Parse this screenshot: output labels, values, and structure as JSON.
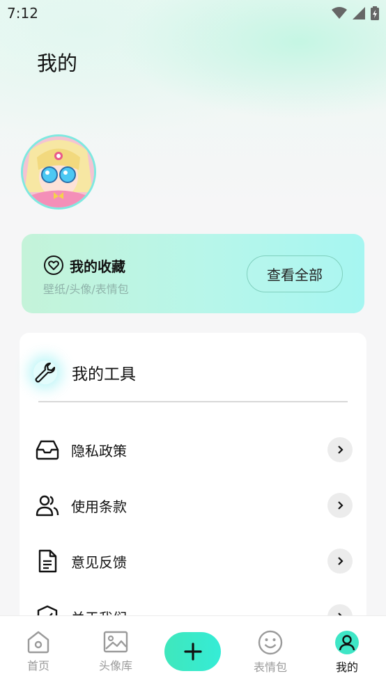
{
  "status_bar": {
    "time": "7:12"
  },
  "page": {
    "title": "我的"
  },
  "favorites": {
    "title": "我的收藏",
    "subtitle": "壁纸/头像/表情包",
    "view_all_label": "查看全部"
  },
  "tools": {
    "title": "我的工具",
    "items": [
      {
        "label": "隐私政策",
        "icon": "inbox-icon"
      },
      {
        "label": "使用条款",
        "icon": "users-icon"
      },
      {
        "label": "意见反馈",
        "icon": "document-icon"
      },
      {
        "label": "关于我们",
        "icon": "shield-check-icon"
      }
    ]
  },
  "bottom_nav": {
    "items": [
      {
        "label": "首页",
        "icon": "home-icon"
      },
      {
        "label": "头像库",
        "icon": "image-icon"
      },
      {
        "label": "",
        "icon": "plus-icon"
      },
      {
        "label": "表情包",
        "icon": "smiley-icon"
      },
      {
        "label": "我的",
        "icon": "profile-icon",
        "active": true
      }
    ]
  },
  "colors": {
    "accent": "#3fe7bc",
    "card_gradient_end": "#a6f6f1"
  }
}
